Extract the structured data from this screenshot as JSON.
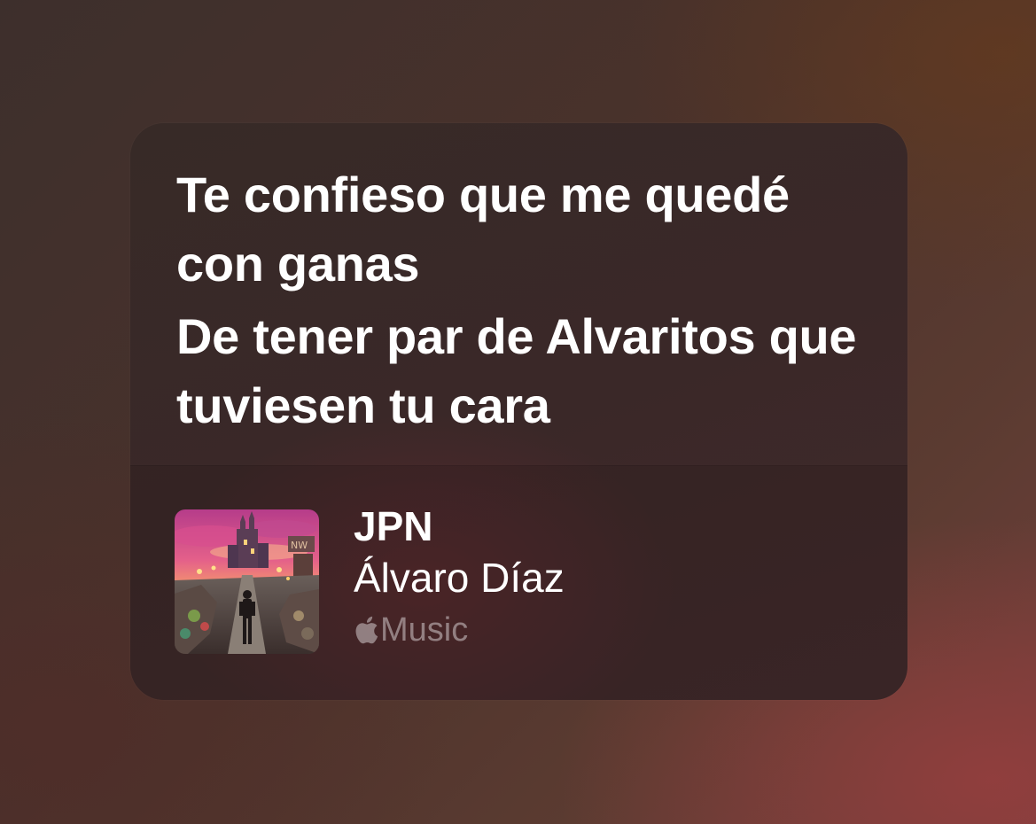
{
  "lyrics": {
    "lines": [
      "Te confieso que me quedé con ganas",
      "De tener par de Alvaritos que tuviesen tu cara"
    ]
  },
  "now_playing": {
    "title": "JPN",
    "artist": "Álvaro Díaz",
    "service": "Music",
    "service_icon": "apple-logo-icon",
    "artwork": "album-artwork"
  },
  "colors": {
    "card_background": "#3a2828",
    "text_primary": "#ffffff",
    "text_secondary": "rgba(255,255,255,0.42)"
  }
}
